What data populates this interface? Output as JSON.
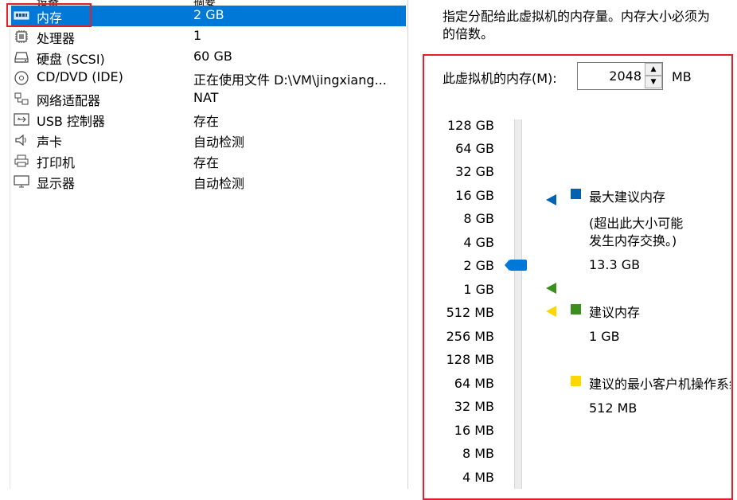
{
  "left_panel": {
    "headers": {
      "device": "设备",
      "summary": "摘要"
    },
    "devices": [
      {
        "icon": "memory-icon",
        "name": "内存",
        "value": "2 GB",
        "selected": true
      },
      {
        "icon": "processor-icon",
        "name": "处理器",
        "value": "1"
      },
      {
        "icon": "hard-disk-icon",
        "name": "硬盘 (SCSI)",
        "value": "60 GB"
      },
      {
        "icon": "cd-dvd-icon",
        "name": "CD/DVD (IDE)",
        "value": "正在使用文件 D:\\VM\\jingxiang..."
      },
      {
        "icon": "network-adapter-icon",
        "name": "网络适配器",
        "value": "NAT"
      },
      {
        "icon": "usb-icon",
        "name": "USB 控制器",
        "value": "存在"
      },
      {
        "icon": "sound-card-icon",
        "name": "声卡",
        "value": "自动检测"
      },
      {
        "icon": "printer-icon",
        "name": "打印机",
        "value": "存在"
      },
      {
        "icon": "display-icon",
        "name": "显示器",
        "value": "自动检测"
      }
    ]
  },
  "right_panel": {
    "description": [
      "指定分配给此虚拟机的内存量。内存大小必须为",
      "的倍数。"
    ],
    "memory_label": "此虚拟机的内存(M):",
    "memory_value": "2048",
    "memory_unit": "MB",
    "scale_labels": [
      "128 GB",
      "64 GB",
      "32 GB",
      "16 GB",
      "8 GB",
      "4 GB",
      "2 GB",
      "1 GB",
      "512 MB",
      "256 MB",
      "128 MB",
      "64 MB",
      "32 MB",
      "16 MB",
      "8 MB",
      "4 MB"
    ],
    "slider_value": "2 GB",
    "legend": {
      "max_recommended": {
        "title": "最大建议内存",
        "note_line1": "(超出此大小可能",
        "note_line2": "发生内存交换。)",
        "value": "13.3 GB",
        "color": "#0063b1"
      },
      "recommended": {
        "title": "建议内存",
        "value": "1 GB",
        "color": "#3a8f1e"
      },
      "min_recommended": {
        "title": "建议的最小客户机操作系统内存",
        "value": "512 MB",
        "color": "#ffd700"
      }
    },
    "colors": {
      "highlight_frame": "#e0202a",
      "selection": "#0078d7"
    }
  }
}
